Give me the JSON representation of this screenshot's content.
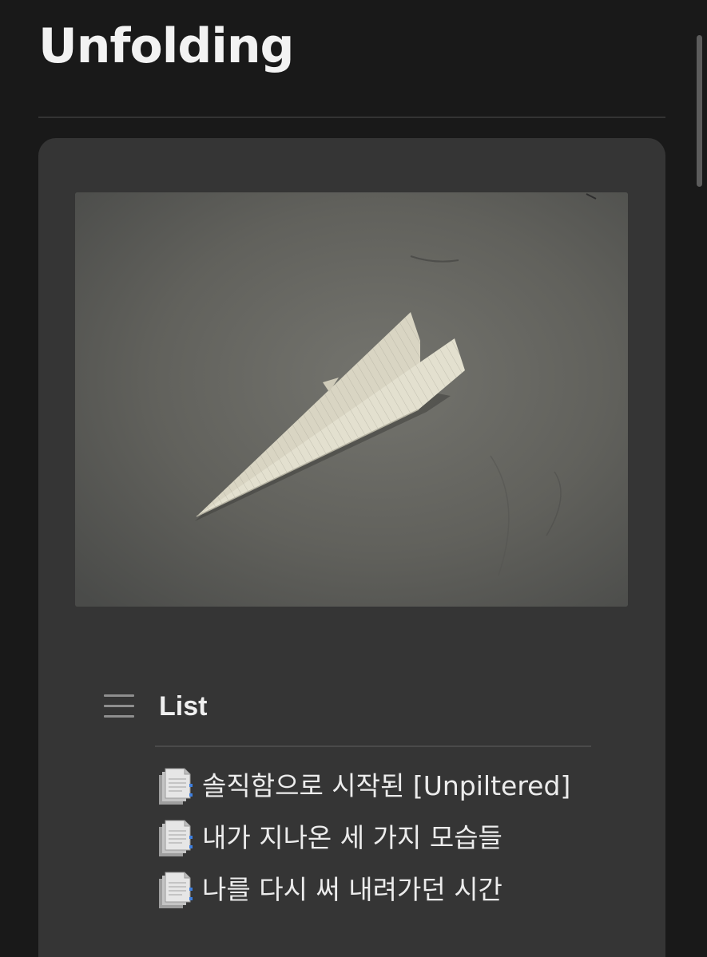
{
  "page": {
    "title": "Unfolding"
  },
  "cover": {
    "image": "paper-airplane-photo"
  },
  "list_section": {
    "heading": "List",
    "icon": "list-icon",
    "items": [
      {
        "label": "솔직함으로 시작된 [Unpiltered]",
        "icon": "document-icon"
      },
      {
        "label": "내가 지나온 세 가지 모습들",
        "icon": "document-icon"
      },
      {
        "label": "나를 다시 써 내려가던 시간",
        "icon": "document-icon"
      }
    ]
  },
  "colors": {
    "background": "#191919",
    "card": "#353535",
    "text": "#f2f2f2"
  }
}
